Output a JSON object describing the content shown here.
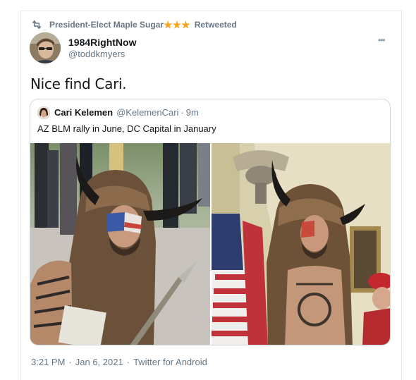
{
  "retweet": {
    "icon": "retweet-icon",
    "name": "President-Elect Maple Sugar",
    "stars": [
      "★",
      "★",
      "★"
    ],
    "action": "Retweeted"
  },
  "tweet": {
    "author_name": "1984RightNow",
    "author_handle": "@toddkmyers",
    "more_label": "•••",
    "text": "Nice find Cari."
  },
  "quote": {
    "author_name": "Cari Kelemen",
    "author_handle": "@KelemenCari",
    "separator": "·",
    "time": "9m",
    "text": "AZ BLM rally in June, DC Capital in January"
  },
  "footer": {
    "time": "3:21 PM",
    "separator": "·",
    "date": "Jan 6, 2021",
    "source": "Twitter for Android"
  },
  "colors": {
    "text_primary": "#14171a",
    "text_secondary": "#657786",
    "border": "#ccd6dd",
    "star": "#f5a623"
  }
}
